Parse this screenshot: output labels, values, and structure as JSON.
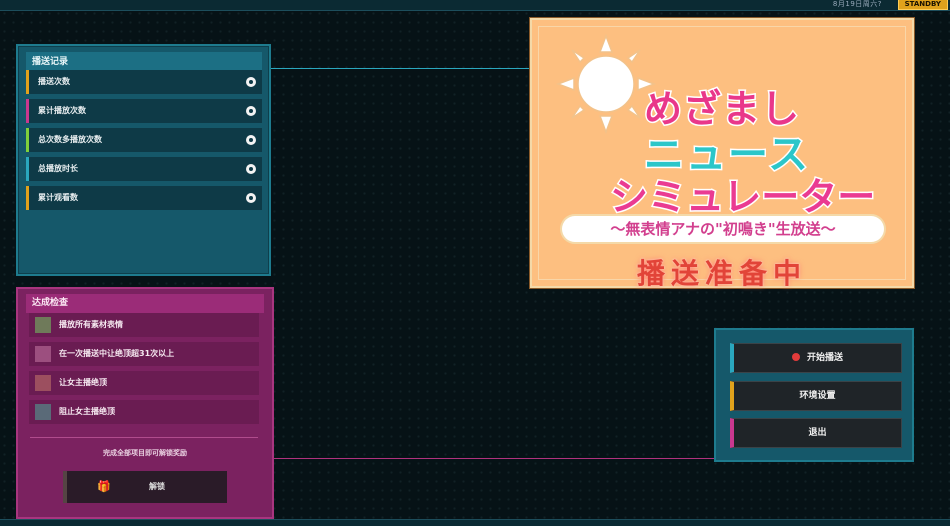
{
  "topbar": {
    "date": "8月19日周六?",
    "status": "STANDBY"
  },
  "record_panel": {
    "title": "播送记录",
    "items": [
      {
        "label": "播送次数",
        "accent": "#e0a21c"
      },
      {
        "label": "累计播放次数",
        "accent": "#c9388f"
      },
      {
        "label": "总次数多播放次数",
        "accent": "#7fd13b"
      },
      {
        "label": "总播放时长",
        "accent": "#2aa7be"
      },
      {
        "label": "累计观看数",
        "accent": "#e0a21c"
      }
    ]
  },
  "achievements_panel": {
    "title": "达成检查",
    "items": [
      {
        "label": "播放所有素材表情",
        "box_color": "#6f7a5a"
      },
      {
        "label": "在一次播送中让绝顶超31次以上",
        "box_color": "#9c4f7f"
      },
      {
        "label": "让女主播绝顶",
        "box_color": "#9c4f5f"
      },
      {
        "label": "阻止女主播绝顶",
        "box_color": "#5a6a78"
      }
    ],
    "note": "完成全部项目即可解锁奖励",
    "unlock_button": {
      "icon": "gift-icon",
      "label": "解锁"
    }
  },
  "title_card": {
    "logo_line1": "めざまし",
    "logo_line2": "ニュース",
    "logo_line3": "シミュレーター",
    "subtitle": "〜無表情アナの\"初鳴き\"生放送〜",
    "status": "播送准备中"
  },
  "menu": {
    "start_broadcast": "开始播送",
    "settings": "环境设置",
    "exit": "退出",
    "accents": {
      "start": "#2aa7be",
      "settings": "#e0a21c",
      "exit": "#c9388f"
    }
  }
}
